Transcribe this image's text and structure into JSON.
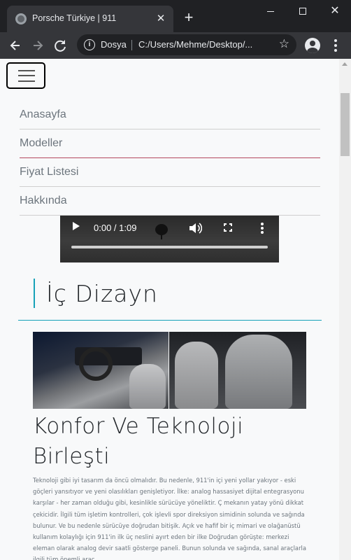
{
  "browser": {
    "tab_title": "Porsche Türkiye | 911",
    "tab_close": "✕",
    "new_tab": "+",
    "url_scheme": "Dosya",
    "url": "C:/Users/Mehme/Desktop/...",
    "info_icon": "i",
    "star_icon": "☆"
  },
  "nav": {
    "items": [
      {
        "label": "Anasayfa"
      },
      {
        "label": "Modeller"
      },
      {
        "label": "Fiyat Listesi"
      },
      {
        "label": "Hakkında"
      }
    ]
  },
  "video": {
    "time": "0:00 / 1:09",
    "progress": 0
  },
  "section": {
    "heading": "İç Dizayn",
    "subheading": "Konfor Ve Teknoloji Birleşti",
    "paragraph": "Teknoloji gibi iyi tasarım da öncü olmalıdır. Bu nedenle, 911'in içi yeni yollar yakıyor - eski göçleri yansıtıyor ve yeni olasılıkları genişletiyor. İlke: analog hassasiyet dijital entegrasyonu karşılar - her zaman olduğu gibi, kesinlikle sürücüye yöneliktir. Ç mekanın yatay yönü dikkat çekicidir. İlgili tüm işletim kontrolleri, çok işlevli spor direksiyon simidinin solunda ve sağında bulunur. Ve bu nedenle sürücüye doğrudan bitişik. Açık ve hafif bir iç mimari ve olağanüstü kullanım kolaylığı için 911'in ilk üç neslini ayırt eden bir ilke Doğrudan görüşte: merkezi eleman olarak analog devir saatli gösterge paneli. Bunun solunda ve sağında, sanal araçlarla ilgili tüm önemli araç"
  },
  "colors": {
    "accent": "#17a2b8",
    "active_underline": "#b5485e",
    "page_bg": "#f8f9fa"
  }
}
